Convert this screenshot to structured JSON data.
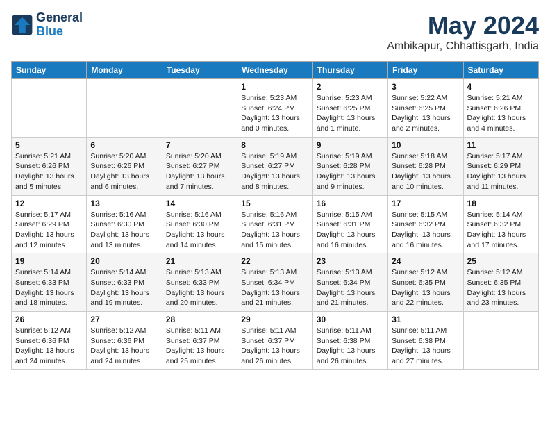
{
  "header": {
    "logo_line1": "General",
    "logo_line2": "Blue",
    "month": "May 2024",
    "location": "Ambikapur, Chhattisgarh, India"
  },
  "weekdays": [
    "Sunday",
    "Monday",
    "Tuesday",
    "Wednesday",
    "Thursday",
    "Friday",
    "Saturday"
  ],
  "weeks": [
    [
      {
        "day": "",
        "info": ""
      },
      {
        "day": "",
        "info": ""
      },
      {
        "day": "",
        "info": ""
      },
      {
        "day": "1",
        "info": "Sunrise: 5:23 AM\nSunset: 6:24 PM\nDaylight: 13 hours\nand 0 minutes."
      },
      {
        "day": "2",
        "info": "Sunrise: 5:23 AM\nSunset: 6:25 PM\nDaylight: 13 hours\nand 1 minute."
      },
      {
        "day": "3",
        "info": "Sunrise: 5:22 AM\nSunset: 6:25 PM\nDaylight: 13 hours\nand 2 minutes."
      },
      {
        "day": "4",
        "info": "Sunrise: 5:21 AM\nSunset: 6:26 PM\nDaylight: 13 hours\nand 4 minutes."
      }
    ],
    [
      {
        "day": "5",
        "info": "Sunrise: 5:21 AM\nSunset: 6:26 PM\nDaylight: 13 hours\nand 5 minutes."
      },
      {
        "day": "6",
        "info": "Sunrise: 5:20 AM\nSunset: 6:26 PM\nDaylight: 13 hours\nand 6 minutes."
      },
      {
        "day": "7",
        "info": "Sunrise: 5:20 AM\nSunset: 6:27 PM\nDaylight: 13 hours\nand 7 minutes."
      },
      {
        "day": "8",
        "info": "Sunrise: 5:19 AM\nSunset: 6:27 PM\nDaylight: 13 hours\nand 8 minutes."
      },
      {
        "day": "9",
        "info": "Sunrise: 5:19 AM\nSunset: 6:28 PM\nDaylight: 13 hours\nand 9 minutes."
      },
      {
        "day": "10",
        "info": "Sunrise: 5:18 AM\nSunset: 6:28 PM\nDaylight: 13 hours\nand 10 minutes."
      },
      {
        "day": "11",
        "info": "Sunrise: 5:17 AM\nSunset: 6:29 PM\nDaylight: 13 hours\nand 11 minutes."
      }
    ],
    [
      {
        "day": "12",
        "info": "Sunrise: 5:17 AM\nSunset: 6:29 PM\nDaylight: 13 hours\nand 12 minutes."
      },
      {
        "day": "13",
        "info": "Sunrise: 5:16 AM\nSunset: 6:30 PM\nDaylight: 13 hours\nand 13 minutes."
      },
      {
        "day": "14",
        "info": "Sunrise: 5:16 AM\nSunset: 6:30 PM\nDaylight: 13 hours\nand 14 minutes."
      },
      {
        "day": "15",
        "info": "Sunrise: 5:16 AM\nSunset: 6:31 PM\nDaylight: 13 hours\nand 15 minutes."
      },
      {
        "day": "16",
        "info": "Sunrise: 5:15 AM\nSunset: 6:31 PM\nDaylight: 13 hours\nand 16 minutes."
      },
      {
        "day": "17",
        "info": "Sunrise: 5:15 AM\nSunset: 6:32 PM\nDaylight: 13 hours\nand 16 minutes."
      },
      {
        "day": "18",
        "info": "Sunrise: 5:14 AM\nSunset: 6:32 PM\nDaylight: 13 hours\nand 17 minutes."
      }
    ],
    [
      {
        "day": "19",
        "info": "Sunrise: 5:14 AM\nSunset: 6:33 PM\nDaylight: 13 hours\nand 18 minutes."
      },
      {
        "day": "20",
        "info": "Sunrise: 5:14 AM\nSunset: 6:33 PM\nDaylight: 13 hours\nand 19 minutes."
      },
      {
        "day": "21",
        "info": "Sunrise: 5:13 AM\nSunset: 6:33 PM\nDaylight: 13 hours\nand 20 minutes."
      },
      {
        "day": "22",
        "info": "Sunrise: 5:13 AM\nSunset: 6:34 PM\nDaylight: 13 hours\nand 21 minutes."
      },
      {
        "day": "23",
        "info": "Sunrise: 5:13 AM\nSunset: 6:34 PM\nDaylight: 13 hours\nand 21 minutes."
      },
      {
        "day": "24",
        "info": "Sunrise: 5:12 AM\nSunset: 6:35 PM\nDaylight: 13 hours\nand 22 minutes."
      },
      {
        "day": "25",
        "info": "Sunrise: 5:12 AM\nSunset: 6:35 PM\nDaylight: 13 hours\nand 23 minutes."
      }
    ],
    [
      {
        "day": "26",
        "info": "Sunrise: 5:12 AM\nSunset: 6:36 PM\nDaylight: 13 hours\nand 24 minutes."
      },
      {
        "day": "27",
        "info": "Sunrise: 5:12 AM\nSunset: 6:36 PM\nDaylight: 13 hours\nand 24 minutes."
      },
      {
        "day": "28",
        "info": "Sunrise: 5:11 AM\nSunset: 6:37 PM\nDaylight: 13 hours\nand 25 minutes."
      },
      {
        "day": "29",
        "info": "Sunrise: 5:11 AM\nSunset: 6:37 PM\nDaylight: 13 hours\nand 26 minutes."
      },
      {
        "day": "30",
        "info": "Sunrise: 5:11 AM\nSunset: 6:38 PM\nDaylight: 13 hours\nand 26 minutes."
      },
      {
        "day": "31",
        "info": "Sunrise: 5:11 AM\nSunset: 6:38 PM\nDaylight: 13 hours\nand 27 minutes."
      },
      {
        "day": "",
        "info": ""
      }
    ]
  ]
}
